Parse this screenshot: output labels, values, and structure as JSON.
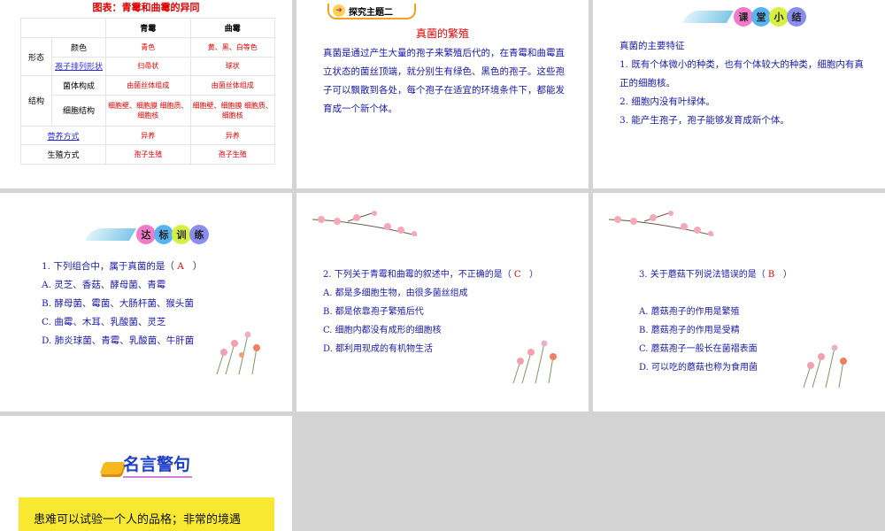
{
  "slide1": {
    "title": "图表：青霉和曲霉的异同",
    "headers": [
      "",
      "",
      "青霉",
      "曲霉"
    ],
    "group_morph": "形态",
    "group_struct": "结构",
    "rows": [
      {
        "label": "颜色",
        "a": "青色",
        "b": "黄、黑、白等色"
      },
      {
        "label": "孢子排列形状",
        "a": "扫帚状",
        "b": "球状"
      },
      {
        "label": "菌体构成",
        "a": "由菌丝体组成",
        "b": "由菌丝体组成"
      },
      {
        "label": "细胞结构",
        "a": "细胞壁、细胞膜 细胞质、细胞核",
        "b": "细胞壁、细胞膜 细胞质、细胞核"
      },
      {
        "label": "营养方式",
        "a": "异养",
        "b": "异养"
      },
      {
        "label": "生殖方式",
        "a": "孢子生殖",
        "b": "孢子生殖"
      }
    ]
  },
  "slide2": {
    "tag": "探究主题二",
    "title": "真菌的繁殖",
    "body": "真菌是通过产生大量的孢子来繁殖后代的，在青霉和曲霉直立状态的菌丝顶端，就分别生有绿色、黑色的孢子。这些孢子可以飘散到各处，每个孢子在适宜的环境条件下，都能发育成一个新个体。"
  },
  "slide3": {
    "badge": [
      "课",
      "堂",
      "小",
      "结"
    ],
    "lines": [
      "真菌的主要特征",
      "1. 既有个体微小的种类，也有个体较大的种类，细胞内有真正的细胞核。",
      "2. 细胞内没有叶绿体。",
      "3. 能产生孢子，孢子能够发育成新个体。"
    ]
  },
  "slide4": {
    "badge": [
      "达",
      "标",
      "训",
      "练"
    ],
    "question": "1. 下列组合中，属于真菌的是（",
    "answer": "A",
    "close": "）",
    "options": [
      "A. 灵芝、香菇、酵母菌、青霉",
      "B. 酵母菌、霉菌、大肠杆菌、猴头菌",
      "C. 曲霉、木耳、乳酸菌、灵芝",
      "D. 肺炎球菌、青霉、乳酸菌、牛肝菌"
    ]
  },
  "slide5": {
    "question": "2. 下列关于青霉和曲霉的叙述中，不正确的是（",
    "answer": "C",
    "close": "）",
    "options": [
      "A. 都是多细胞生物，由很多菌丝组成",
      "B. 都是依靠孢子繁殖后代",
      "C. 细胞内都没有成形的细胞核",
      "D. 都利用现成的有机物生活"
    ]
  },
  "slide6": {
    "question": "3. 关于蘑菇下列说法错误的是（",
    "answer": "B",
    "close": "）",
    "options": [
      "A. 蘑菇孢子的作用是繁殖",
      "B. 蘑菇孢子的作用是受精",
      "C. 蘑菇孢子一般长在菌褶表面",
      "D. 可以吃的蘑菇也称为食用菌"
    ]
  },
  "slide7": {
    "title": "名言警句",
    "quote": "患难可以试验一个人的品格；非常的境遇"
  }
}
